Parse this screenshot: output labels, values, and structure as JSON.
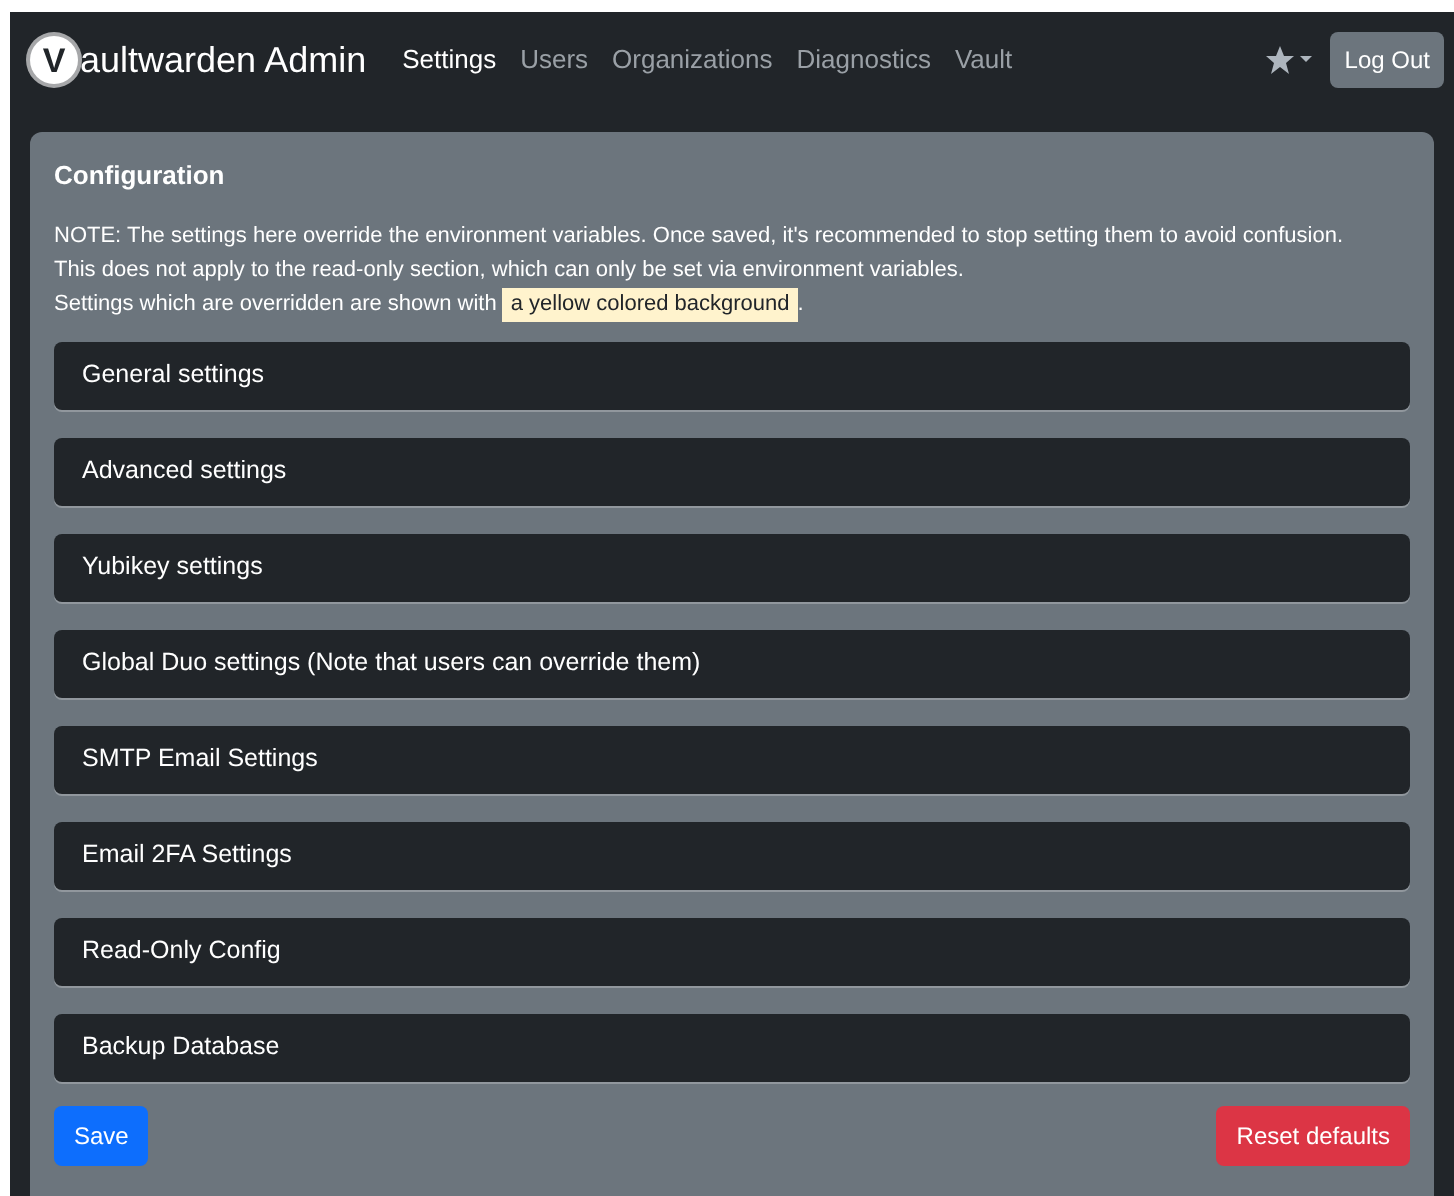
{
  "navbar": {
    "brand": {
      "icon_letter": "V",
      "text": "aultwarden Admin"
    },
    "links": [
      {
        "label": "Settings",
        "selected": true
      },
      {
        "label": "Users",
        "selected": false
      },
      {
        "label": "Organizations",
        "selected": false
      },
      {
        "label": "Diagnostics",
        "selected": false
      },
      {
        "label": "Vault",
        "selected": false
      }
    ],
    "logout": "Log Out"
  },
  "card": {
    "title": "Configuration",
    "note_lines": [
      "NOTE: The settings here override the environment variables. Once saved, it's recommended to stop setting them to avoid confusion.",
      "This does not apply to the read-only section, which can only be set via environment variables."
    ],
    "highlight_line": {
      "before": "Settings which are overridden are shown with",
      "highlight": "a yellow colored background",
      "after": "."
    },
    "sections": [
      "General settings",
      "Advanced settings",
      "Yubikey settings",
      "Global Duo settings (Note that users can override them)",
      "SMTP Email Settings",
      "Email 2FA Settings",
      "Read-Only Config",
      "Backup Database"
    ],
    "buttons": {
      "save": "Save",
      "reset": "Reset defaults"
    }
  }
}
